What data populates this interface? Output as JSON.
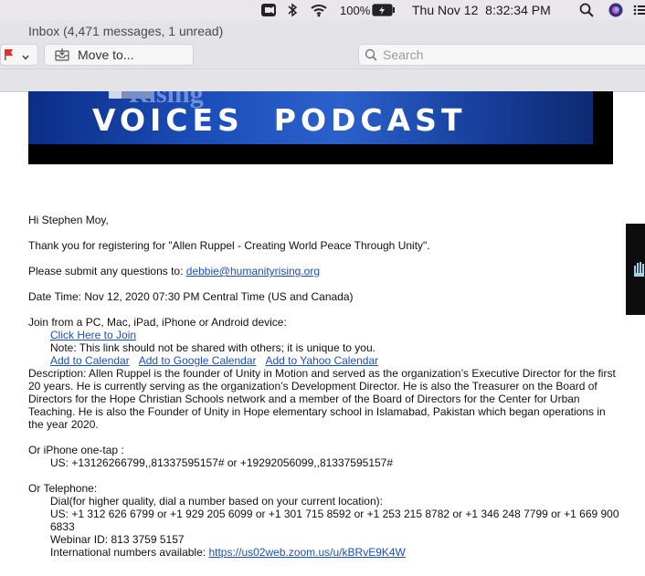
{
  "menubar": {
    "battery_percent": "100%",
    "datetime": "Thu Nov 12  8:32:34 PM",
    "icons": [
      "screen-record-icon",
      "bluetooth-icon",
      "wifi-icon",
      "battery-icon",
      "spotlight-search-icon",
      "siri-icon",
      "control-strip-icon"
    ]
  },
  "toolbar": {
    "window_title": "Inbox (4,471 messages, 1 unread)",
    "move_to_label": "Move to...",
    "search_placeholder": "Search"
  },
  "banner": {
    "subtitle_partial": "Rising",
    "title": "VOICES  PODCAST"
  },
  "email": {
    "greeting": "Hi Stephen Moy,",
    "thanks": "Thank you for registering for \"Allen Ruppel - Creating World Peace Through Unity\".",
    "questions_prefix": "Please submit any questions to: ",
    "questions_email": "debbie@humanityrising.org",
    "datetime_line": "Date Time: Nov 12, 2020 07:30 PM Central Time (US and Canada)",
    "join_line": "Join from a PC, Mac, iPad, iPhone or Android device:",
    "join_link": "Click Here to Join",
    "note": "Note: This link should not be shared with others; it is unique to you.",
    "calendar_links": [
      "Add to Calendar",
      "Add to Google Calendar",
      "Add to Yahoo Calendar"
    ],
    "description": "Description: Allen Ruppel is the founder of Unity in Motion and served as the organization’s Executive Director for the first 20 years. He is currently serving as the organization’s Development Director. He is also the Treasurer on the Board of Directors for the Hope Christian Schools network and a member of the Board of Directors for the Center for Urban Teaching. He is also the Founder of Unity in Hope elementary school in Islamabad, Pakistan which began operations in the year 2020.",
    "iphone_heading": "Or iPhone one-tap :",
    "iphone_numbers": "US: +13126266799,,81337595157# or +19292056099,,81337595157#",
    "telephone_heading": "Or Telephone:",
    "dial_note": "Dial(for higher quality, dial a number based on your current location):",
    "us_numbers": "US: +1 312 626 6799 or +1 929 205 6099 or +1 301 715 8592 or +1 253 215 8782 or +1 346 248 7799 or +1 669 900 6833",
    "webinar_id": "Webinar ID: 813 3759 5157",
    "intl_prefix": "International numbers available: ",
    "intl_link": "https://us02web.zoom.us/u/kBRvE9K4W"
  },
  "colors": {
    "link": "#1a4fbf",
    "flag": "#e2302a",
    "banner_blue": "#1b4db8"
  }
}
